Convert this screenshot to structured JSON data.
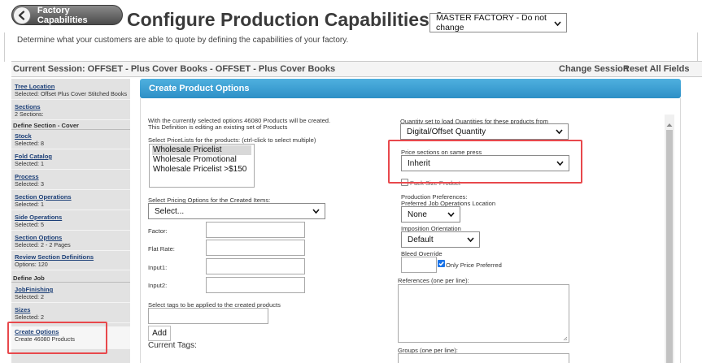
{
  "header": {
    "back_button": "Factory Capabilities",
    "title": "Configure Production Capabilities for",
    "factory_select": "MASTER FACTORY - Do not change",
    "subtitle": "Determine what your customers are able to quote by defining the capabilities of your factory."
  },
  "session": {
    "text": "Current Session: OFFSET - Plus Cover Books - OFFSET - Plus Cover Books",
    "change": "Change Session",
    "reset": "Reset All Fields"
  },
  "sidebar": {
    "tree_location": {
      "label": "Tree Location",
      "sub": "Selected: Offset Plus Cover Stitched Books"
    },
    "sections": {
      "label": "Sections",
      "sub": "2 Sections:"
    },
    "define_cover": "Define Section - Cover",
    "items_cover": [
      {
        "label": "Stock",
        "sub": "Selected: 8"
      },
      {
        "label": "Fold Catalog",
        "sub": "Selected: 1"
      },
      {
        "label": "Process",
        "sub": "Selected: 3"
      },
      {
        "label": "Section Operations",
        "sub": "Selected: 1"
      },
      {
        "label": "Side Operations",
        "sub": "Selected: 5"
      },
      {
        "label": "Section Options",
        "sub": "Selected: 2 - 2 Pages"
      },
      {
        "label": "Review Section Definitions",
        "sub": "Options: 120"
      }
    ],
    "define_job": "Define Job",
    "items_job": [
      {
        "label": "JobFinishing",
        "sub": "Selected: 2"
      },
      {
        "label": "Sizes",
        "sub": "Selected: 2"
      }
    ],
    "create_options": {
      "label": "Create Options",
      "sub": "Create 46080 Products"
    }
  },
  "main": {
    "title": "Create Product Options",
    "intro1": "With the currently selected options 46080 Products will be created.",
    "intro2": "This Definition is editing an existing set of Products",
    "pricelists_label": "Select PriceLists for the products: (ctrl-click to select multiple)",
    "pricelists": [
      "Wholesale Pricelist",
      "Wholesale Promotional",
      "Wholesale Pricelist >$150"
    ],
    "pricing_options_label": "Select Pricing Options for the Created Items:",
    "pricing_options_value": "Select...",
    "factor_label": "Factor:",
    "flat_rate_label": "Flat Rate:",
    "input1_label": "Input1:",
    "input2_label": "Input2:",
    "tags_label": "Select tags to be applied to the created products",
    "add_label": "Add",
    "current_tags_label": "Current Tags:",
    "quantity_label": "Quantity set to load Quantities for these products from",
    "quantity_value": "Digital/Offset Quantity",
    "price_sections_label": "Price sections on same press",
    "price_sections_value": "Inherit",
    "pack_size_label": "Pack Size Product",
    "production_prefs_label": "Production Preferences:",
    "job_ops_label": "Preferred Job Operations Location",
    "job_ops_value": "None",
    "imposition_label": "Imposition Orientation",
    "imposition_value": "Default",
    "bleed_label": "Bleed Override",
    "only_price_label": "Only Price Preferred",
    "references_label": "References (one per line):",
    "groups_label": "Groups (one per line):"
  }
}
